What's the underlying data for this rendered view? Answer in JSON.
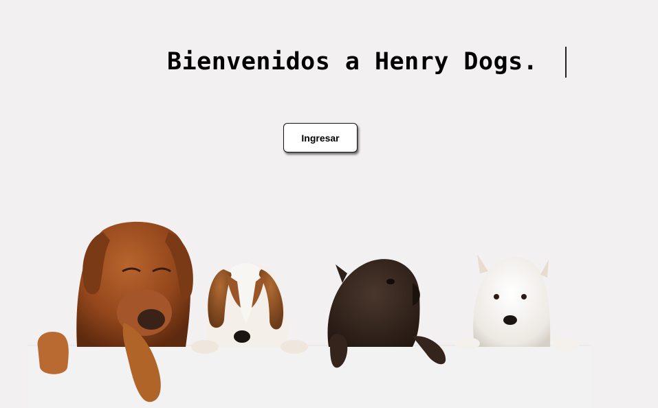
{
  "landing": {
    "title": "Bienvenidos a Henry Dogs.",
    "enter_button_label": "Ingresar"
  },
  "illustration": {
    "icon": "dogs-peeking-over-board-image",
    "dogs": [
      "rhodesian-ridgeback",
      "beagle",
      "scottish-terrier",
      "west-highland-terrier"
    ]
  },
  "colors": {
    "background": "#f2f0f1",
    "button_background": "#ffffff",
    "text": "#000000"
  }
}
